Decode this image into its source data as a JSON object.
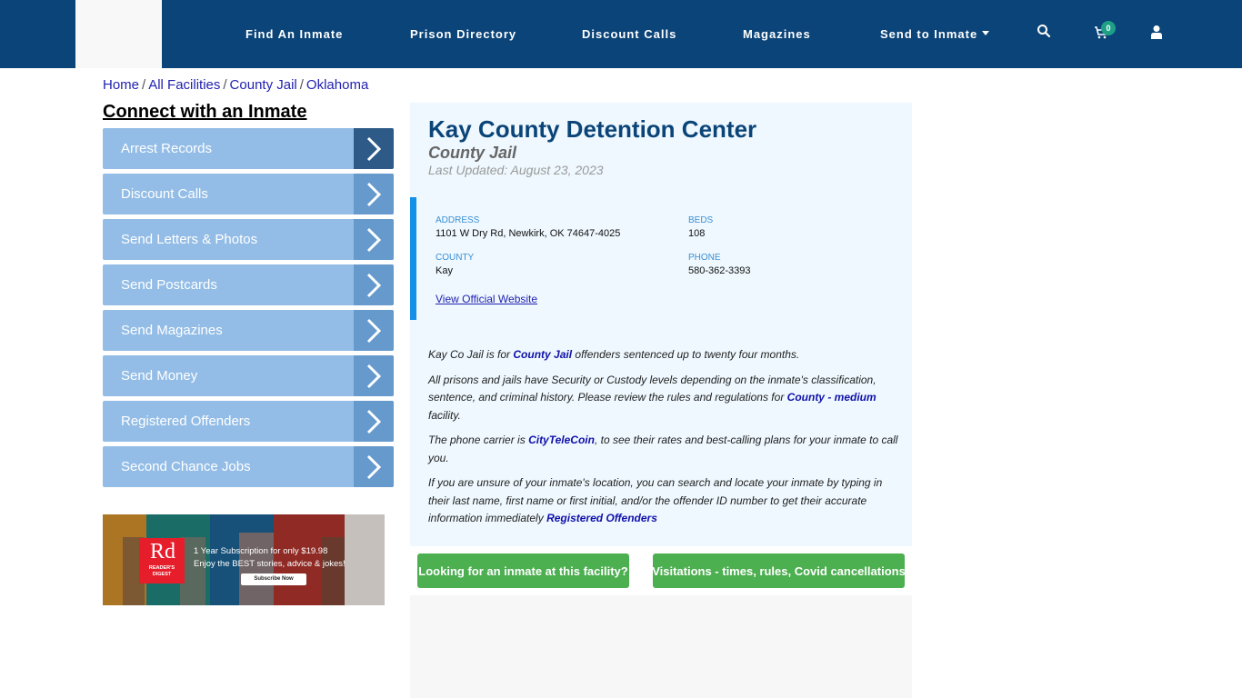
{
  "header": {
    "nav": [
      {
        "label": "Find An Inmate"
      },
      {
        "label": "Prison Directory"
      },
      {
        "label": "Discount Calls"
      },
      {
        "label": "Magazines"
      },
      {
        "label": "Send to Inmate",
        "has_dropdown": true
      }
    ],
    "cart_count": "0",
    "icons": [
      "search-icon",
      "cart-icon",
      "user-icon"
    ],
    "colors": {
      "bar": "#0b4478",
      "badge": "#1ea086"
    }
  },
  "breadcrumb": [
    {
      "label": "Home"
    },
    {
      "label": "All Facilities"
    },
    {
      "label": "County Jail"
    },
    {
      "label": "Oklahoma"
    }
  ],
  "sidebar": {
    "title": "Connect with an Inmate",
    "items": [
      {
        "label": "Arrest Records"
      },
      {
        "label": "Discount Calls"
      },
      {
        "label": "Send Letters & Photos"
      },
      {
        "label": "Send Postcards"
      },
      {
        "label": "Send Magazines"
      },
      {
        "label": "Send Money"
      },
      {
        "label": "Registered Offenders"
      },
      {
        "label": "Second Chance Jobs"
      }
    ],
    "ad": {
      "brand_short": "Rd",
      "brand_name": "READER'S DIGEST",
      "line1": "1 Year Subscription for only $19.98",
      "line2": "Enjoy the BEST stories, advice & jokes!",
      "cta": "Subscribe Now",
      "cover_title": "Reader's digest"
    }
  },
  "facility": {
    "name": "Kay County Detention Center",
    "type": "County Jail",
    "last_updated": "Last Updated: August 23, 2023",
    "info": {
      "address_label": "ADDRESS",
      "address": "1101 W Dry Rd, Newkirk, OK 74647-4025",
      "beds_label": "BEDS",
      "beds": "108",
      "county_label": "COUNTY",
      "county": "Kay",
      "phone_label": "PHONE",
      "phone": "580-362-3393",
      "website_link": "View Official Website"
    },
    "description": {
      "p1_a": "Kay Co Jail is for ",
      "p1_link": "County Jail",
      "p1_b": " offenders sentenced up to twenty four months.",
      "p2_a": "All prisons and jails have Security or Custody levels depending on the inmate's classification, sentence, and criminal history. Please review the rules and regulations for ",
      "p2_link": "County - medium",
      "p2_b": " facility.",
      "p3_a": "The phone carrier is ",
      "p3_link": "CityTeleCoin",
      "p3_b": ", to see their rates and best-calling plans for your inmate to call you.",
      "p4_a": "If you are unsure of your inmate's location, you can search and locate your inmate by typing in their last name, first name or first initial, and/or the offender ID number to get their accurate information immediately ",
      "p4_link": "Registered Offenders"
    },
    "buttons": {
      "find_inmate": "Looking for an inmate at this facility?",
      "visitations": "Visitations - times, rules, Covid cancellations"
    }
  }
}
